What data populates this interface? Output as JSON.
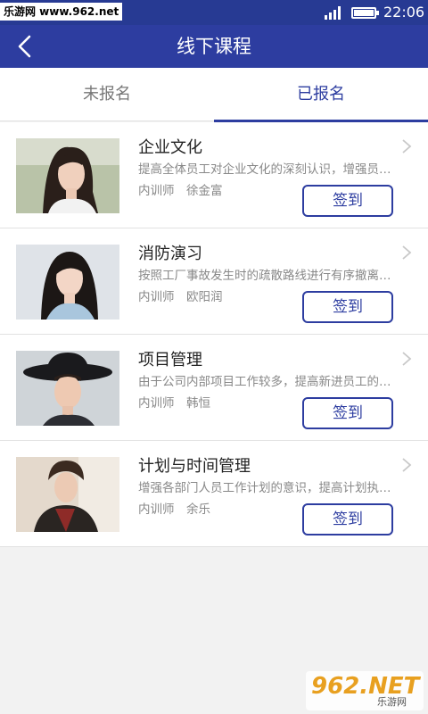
{
  "status_bar": {
    "watermark": "乐游网 www.962.net",
    "time": "22:06"
  },
  "header": {
    "title": "线下课程",
    "background_color": "#2d3da0"
  },
  "tabs": [
    {
      "label": "未报名",
      "active": false
    },
    {
      "label": "已报名",
      "active": true
    }
  ],
  "courses": [
    {
      "title": "企业文化",
      "description": "提高全体员工对企业文化的深刻认识，增强员工凝聚力",
      "trainer_role": "内训师",
      "trainer_name": "徐金富",
      "button_label": "签到"
    },
    {
      "title": "消防演习",
      "description": "按照工厂事故发生时的疏散路线进行有序撤离演练",
      "trainer_role": "内训师",
      "trainer_name": "欧阳润",
      "button_label": "签到"
    },
    {
      "title": "项目管理",
      "description": "由于公司内部项目工作较多，提高新进员工的管理能力",
      "trainer_role": "内训师",
      "trainer_name": "韩恒",
      "button_label": "签到"
    },
    {
      "title": "计划与时间管理",
      "description": "增强各部门人员工作计划的意识，提高计划执行能力",
      "trainer_role": "内训师",
      "trainer_name": "余乐",
      "button_label": "签到"
    }
  ],
  "bottom_watermark": {
    "logo_text": "962.NET",
    "caption": "乐游网"
  },
  "icons": {
    "back": "back-arrow-icon",
    "chevron": "chevron-right-icon",
    "signal": "signal-icon",
    "battery": "battery-icon"
  }
}
